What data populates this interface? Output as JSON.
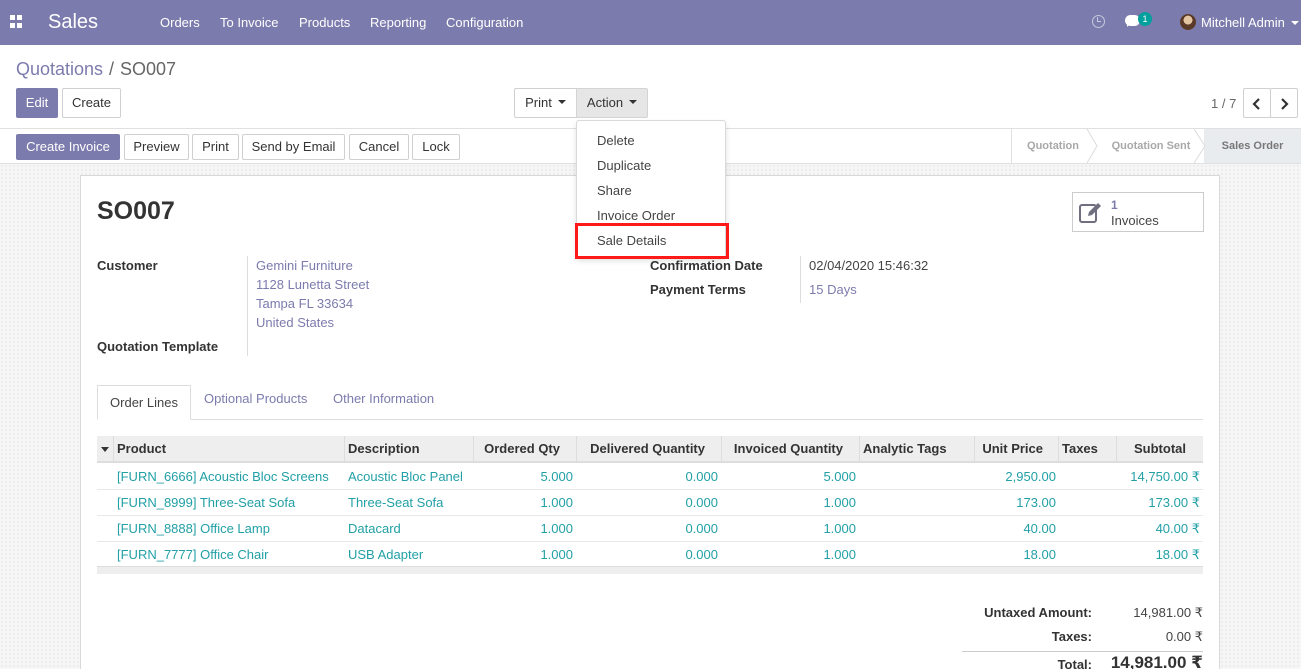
{
  "navbar": {
    "app_title": "Sales",
    "menu": [
      "Orders",
      "To Invoice",
      "Products",
      "Reporting",
      "Configuration"
    ],
    "chat_count": "1",
    "user_name": "Mitchell Admin",
    "icons": [
      "apps-grid-icon",
      "clock-icon",
      "chat-icon",
      "avatar"
    ]
  },
  "breadcrumb": {
    "parent": "Quotations",
    "separator": "/",
    "current": "SO007"
  },
  "buttons": {
    "edit": "Edit",
    "create": "Create",
    "print": "Print",
    "action": "Action"
  },
  "pager": {
    "value": "1 / 7"
  },
  "action_menu": {
    "items": [
      "Delete",
      "Duplicate",
      "Share",
      "Invoice Order",
      "Sale Details"
    ],
    "highlighted": "Sale Details"
  },
  "statusbar": {
    "buttons": [
      "Create Invoice",
      "Preview",
      "Print",
      "Send by Email",
      "Cancel",
      "Lock"
    ],
    "stages": [
      "Quotation",
      "Quotation Sent",
      "Sales Order"
    ],
    "current_stage": "Sales Order"
  },
  "record": {
    "name": "SO007",
    "smart_button": {
      "count": "1",
      "label": "Invoices"
    },
    "customer_label": "Customer",
    "customer_lines": [
      "Gemini Furniture",
      "1128 Lunetta Street",
      "Tampa FL 33634",
      "United States"
    ],
    "template_label": "Quotation Template",
    "confirmation_label": "Confirmation Date",
    "confirmation_value": "02/04/2020 15:46:32",
    "terms_label": "Payment Terms",
    "terms_value": "15 Days"
  },
  "tabs": [
    "Order Lines",
    "Optional Products",
    "Other Information"
  ],
  "order_lines": {
    "columns": [
      "Product",
      "Description",
      "Ordered Qty",
      "Delivered Quantity",
      "Invoiced Quantity",
      "Analytic Tags",
      "Unit Price",
      "Taxes",
      "Subtotal"
    ],
    "rows": [
      [
        "[FURN_6666] Acoustic Bloc Screens",
        "Acoustic Bloc Panel",
        "5.000",
        "0.000",
        "5.000",
        "",
        "2,950.00",
        "",
        "14,750.00 ₹"
      ],
      [
        "[FURN_8999] Three-Seat Sofa",
        "Three-Seat Sofa",
        "1.000",
        "0.000",
        "1.000",
        "",
        "173.00",
        "",
        "173.00 ₹"
      ],
      [
        "[FURN_8888] Office Lamp",
        "Datacard",
        "1.000",
        "0.000",
        "1.000",
        "",
        "40.00",
        "",
        "40.00 ₹"
      ],
      [
        "[FURN_7777] Office Chair",
        "USB Adapter",
        "1.000",
        "0.000",
        "1.000",
        "",
        "18.00",
        "",
        "18.00 ₹"
      ]
    ]
  },
  "totals": {
    "untaxed_label": "Untaxed Amount:",
    "untaxed_value": "14,981.00 ₹",
    "taxes_label": "Taxes:",
    "taxes_value": "0.00 ₹",
    "total_label": "Total:",
    "total_value": "14,981.00 ₹"
  },
  "colors": {
    "brand": "#7c7bad",
    "link": "#22a0a6",
    "highlight_box": "#ff1a1a",
    "chat_badge": "#00a09d"
  }
}
